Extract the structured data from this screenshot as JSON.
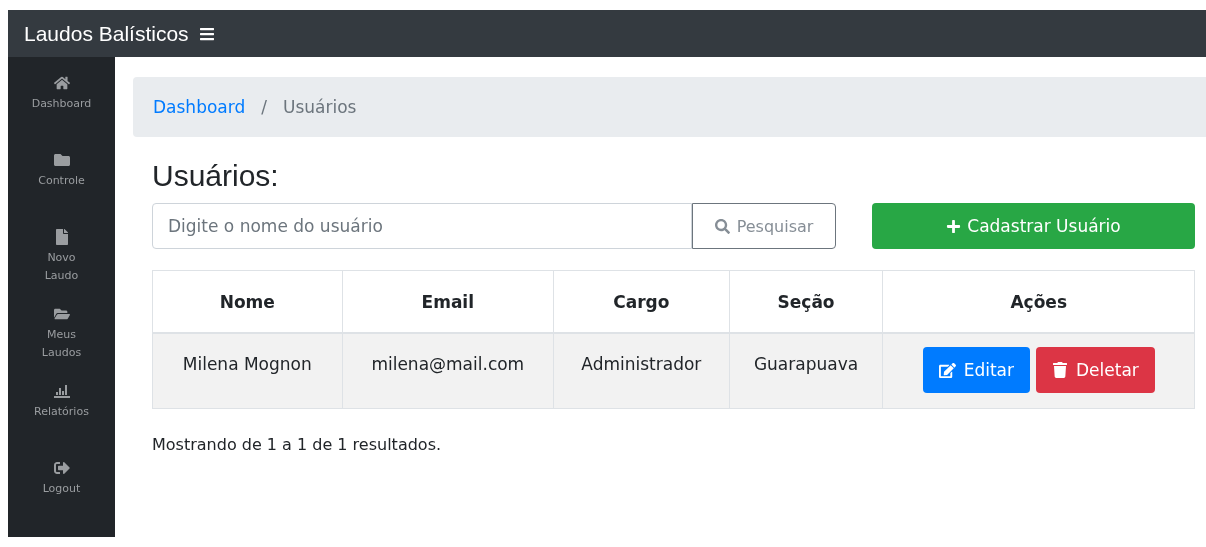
{
  "navbar": {
    "brand": "Laudos Balísticos"
  },
  "sidebar": {
    "items": [
      {
        "label": "Dashboard",
        "kind": "home"
      },
      {
        "label": "Controle",
        "kind": "folder"
      },
      {
        "label": "Novo Laudo",
        "kind": "file"
      },
      {
        "label": "Meus Laudos",
        "kind": "folder-open"
      },
      {
        "label": "Relatórios",
        "kind": "chart"
      },
      {
        "label": "Logout",
        "kind": "logout"
      }
    ]
  },
  "breadcrumb": [
    {
      "label": "Dashboard",
      "kind": "link"
    },
    {
      "label": "Usuários",
      "kind": "current",
      "separator": "/"
    }
  ],
  "page_title": "Usuários:",
  "search": {
    "placeholder": "Digite o nome do usuário",
    "button": "Pesquisar"
  },
  "add_button": "Cadastrar Usuário",
  "table": {
    "columns": [
      "Nome",
      "Email",
      "Cargo",
      "Seção",
      "Ações"
    ],
    "rows": [
      {
        "cells": [
          "Milena Mognon",
          "milena@mail.com",
          "Administrador",
          "Guarapuava"
        ],
        "actions": [
          {
            "label": "Editar",
            "kind": "edit"
          },
          {
            "label": "Deletar",
            "kind": "delete"
          }
        ]
      }
    ]
  },
  "footer_text": "Mostrando de 1 a 1 de 1 resultados."
}
